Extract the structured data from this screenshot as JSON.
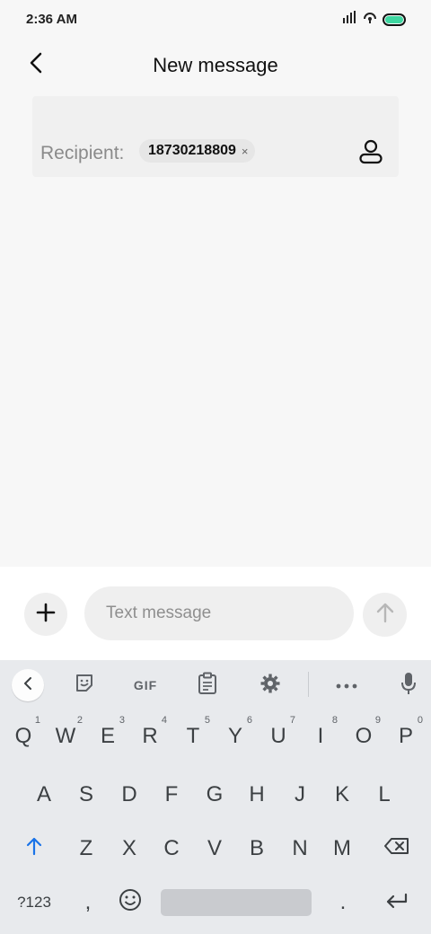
{
  "status_bar": {
    "time": "2:36 AM"
  },
  "header": {
    "title": "New message"
  },
  "recipient": {
    "label": "Recipient:",
    "chip_number": "18730218809",
    "chip_remove": "×"
  },
  "compose": {
    "placeholder": "Text message"
  },
  "keyboard": {
    "toolbar": {
      "gif_label": "GIF"
    },
    "row1": [
      {
        "key": "Q",
        "hint": "1"
      },
      {
        "key": "W",
        "hint": "2"
      },
      {
        "key": "E",
        "hint": "3"
      },
      {
        "key": "R",
        "hint": "4"
      },
      {
        "key": "T",
        "hint": "5"
      },
      {
        "key": "Y",
        "hint": "6"
      },
      {
        "key": "U",
        "hint": "7"
      },
      {
        "key": "I",
        "hint": "8"
      },
      {
        "key": "O",
        "hint": "9"
      },
      {
        "key": "P",
        "hint": "0"
      }
    ],
    "row2": [
      "A",
      "S",
      "D",
      "F",
      "G",
      "H",
      "J",
      "K",
      "L"
    ],
    "row3": [
      "Z",
      "X",
      "C",
      "V",
      "B",
      "N",
      "M"
    ],
    "row4": {
      "symbols": "?123",
      "comma": ",",
      "period": "."
    }
  },
  "colors": {
    "battery": "#3ed6a0",
    "shift_accent": "#1a73e8"
  }
}
